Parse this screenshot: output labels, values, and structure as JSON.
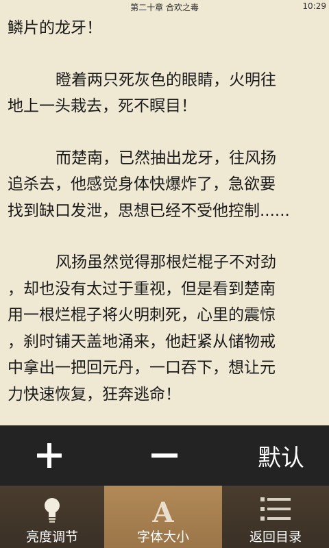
{
  "status": {
    "chapter_title": "第二十章 合欢之毒",
    "time": "10:29"
  },
  "reader": {
    "lines": [
      "鳞片的龙牙！",
      "瞪着两只死灰色的眼睛，火明往",
      "地上一头栽去，死不瞑目！",
      "而楚南，已然抽出龙牙，往风扬",
      "追杀去，他感觉身体快爆炸了，急欲要",
      "找到缺口发泄，思想已经不受他控制......",
      "风扬虽然觉得那根烂棍子不对劲",
      "，却也没有太过于重视，但是看到楚南",
      "用一根烂棍子将火明刺死，心里的震惊",
      "，刹时铺天盖地涌来，他赶紧从储物戒",
      "中拿出一把回元丹，一口吞下，想让元",
      "力快速恢复，狂奔逃命！"
    ]
  },
  "font_toolbar": {
    "increase_icon": "plus-icon",
    "decrease_icon": "minus-icon",
    "default_label": "默认"
  },
  "bottom_nav": {
    "tabs": [
      {
        "label": "亮度调节",
        "icon": "lightbulb-icon"
      },
      {
        "label": "字体大小",
        "icon": "font-a-icon"
      },
      {
        "label": "返回目录",
        "icon": "list-icon"
      }
    ],
    "selected_tab": "字体大小"
  },
  "colors": {
    "background": "#efe8d2",
    "text": "#1a1a1a",
    "toolbar": "#232323",
    "nav": "#3f3429",
    "nav_active": "#a57e4e"
  }
}
